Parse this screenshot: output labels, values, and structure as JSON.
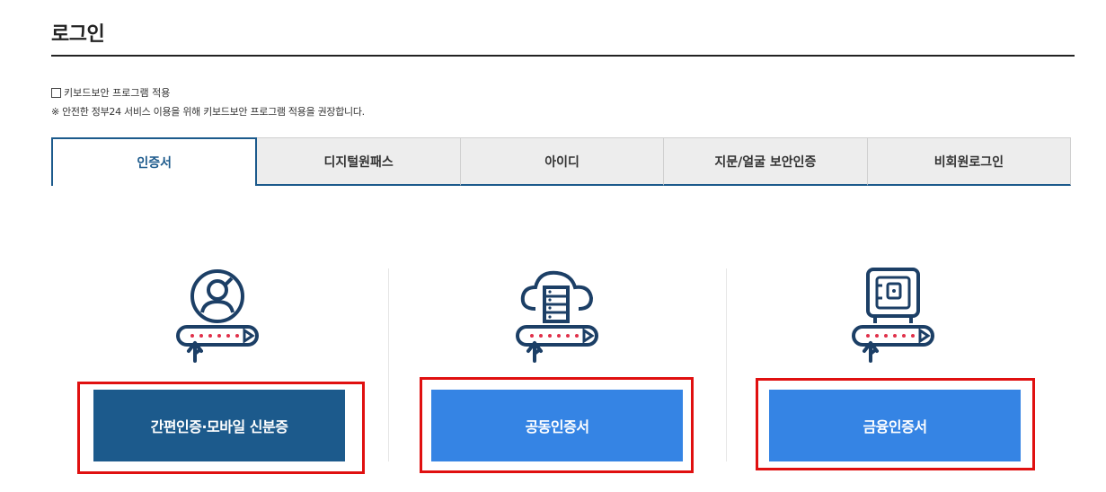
{
  "page": {
    "title": "로그인"
  },
  "keyboard_security": {
    "checkbox_label": "키보드보안 프로그램 적용",
    "note": "※ 안전한 정부24 서비스 이용을 위해 키보드보안 프로그램 적용을 권장합니다."
  },
  "tabs": [
    {
      "label": "인증서",
      "active": true
    },
    {
      "label": "디지털원패스",
      "active": false
    },
    {
      "label": "아이디",
      "active": false
    },
    {
      "label": "지문/얼굴 보안인증",
      "active": false
    },
    {
      "label": "비회원로그인",
      "active": false
    }
  ],
  "options": [
    {
      "label": "간편인증·모바일 신분증",
      "icon": "user-key-icon"
    },
    {
      "label": "공동인증서",
      "icon": "cloud-server-key-icon"
    },
    {
      "label": "금융인증서",
      "icon": "safe-key-icon"
    }
  ],
  "colors": {
    "primary_dark": "#1c5a8c",
    "primary_light": "#3584e4",
    "highlight": "#e01010"
  }
}
